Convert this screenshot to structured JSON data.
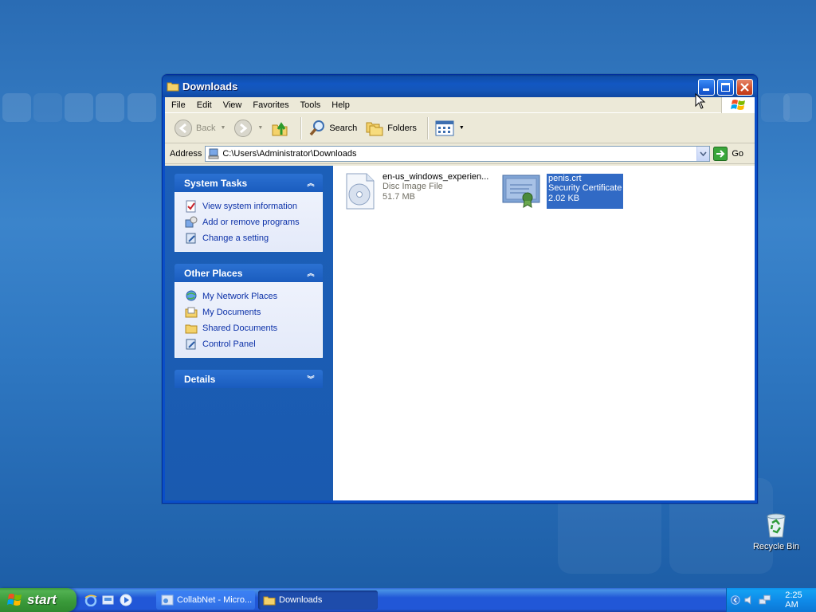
{
  "window": {
    "title": "Downloads"
  },
  "menubar": {
    "items": [
      "File",
      "Edit",
      "View",
      "Favorites",
      "Tools",
      "Help"
    ]
  },
  "toolbar": {
    "back_label": "Back",
    "search_label": "Search",
    "folders_label": "Folders"
  },
  "addressbar": {
    "label": "Address",
    "value": "C:\\Users\\Administrator\\Downloads",
    "go_label": "Go"
  },
  "taskpane": {
    "system_tasks": {
      "title": "System Tasks",
      "items": [
        "View system information",
        "Add or remove programs",
        "Change a setting"
      ]
    },
    "other_places": {
      "title": "Other Places",
      "items": [
        "My Network Places",
        "My Documents",
        "Shared Documents",
        "Control Panel"
      ]
    },
    "details": {
      "title": "Details"
    }
  },
  "files": [
    {
      "name": "en-us_windows_experien...",
      "type": "Disc Image File",
      "size": "51.7 MB",
      "icon": "disc-image-icon",
      "selected": false
    },
    {
      "name": "penis.crt",
      "type": "Security Certificate",
      "size": "2.02 KB",
      "icon": "certificate-icon",
      "selected": true
    }
  ],
  "desktop": {
    "recycle_bin_label": "Recycle Bin"
  },
  "taskbar": {
    "start_label": "start",
    "tasks": [
      {
        "label": "CollabNet - Micro...",
        "active": false
      },
      {
        "label": "Downloads",
        "active": true
      }
    ],
    "clock": "2:25 AM"
  },
  "colors": {
    "desktop": "#2f78c2",
    "titlebar": "#1257c2",
    "taskpane": "#1a5aaf",
    "selection": "#316ac5",
    "link": "#0c31a8",
    "start_button": "#3a9a3a"
  }
}
